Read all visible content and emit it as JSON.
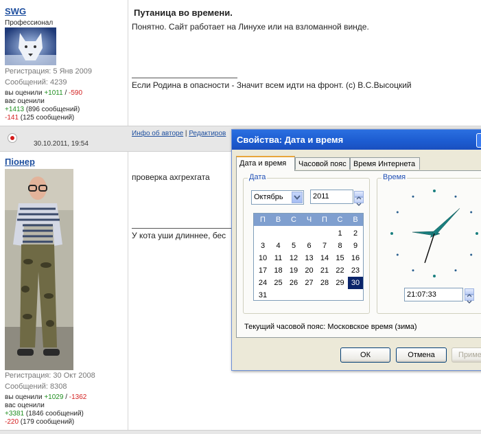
{
  "posts": [
    {
      "username": "SWG",
      "rank": "Профессионал",
      "registration": "Регистрация: 5 Янв 2009",
      "messages": "Сообщений: 4239",
      "rated_label": "вы оценили",
      "rated_pos": "+1011",
      "rated_sep": " / ",
      "rated_neg": "-590",
      "rated_you_label": "вас оценили",
      "rep_pos": "+1413",
      "rep_pos_count": " (896 сообщений)",
      "rep_neg": "-141",
      "rep_neg_count": " (125 сообщений)",
      "title": "Путаница во времени.",
      "text": "Понятно. Сайт работает на Линухе или на взломанной винде.",
      "signature": "Если Родина в опасности - Значит всем идти на фронт. (с) В.С.Высоцкий"
    },
    {
      "username": "Пiонер",
      "registration": "Регистрация: 30 Окт 2008",
      "messages": "Сообщений: 8308",
      "rated_label": "вы оценили",
      "rated_pos": "+1029",
      "rated_sep": " / ",
      "rated_neg": "-1362",
      "rated_you_label": "вас оценили",
      "rep_pos": "+3381",
      "rep_pos_count": " (1846 сообщений)",
      "rep_neg": "-220",
      "rep_neg_count": " (179 сообщений)",
      "text": "проверка ахгрехгата",
      "signature": "У кота уши длиннее, бес"
    }
  ],
  "bar": {
    "datetime": "30.10.2011, 19:54",
    "about_link": "Инфо об авторе",
    "separator": " | ",
    "edit_link": "Редактиров"
  },
  "dialog": {
    "title": "Свойства: Дата и время",
    "tabs": [
      "Дата и время",
      "Часовой пояс",
      "Время Интернета"
    ],
    "date_group": "Дата",
    "time_group": "Время",
    "month": "Октябрь",
    "year": "2011",
    "weekdays": [
      "П",
      "В",
      "С",
      "Ч",
      "П",
      "С",
      "В"
    ],
    "days": [
      [
        "",
        "",
        "",
        "",
        "",
        "1",
        "2"
      ],
      [
        "3",
        "4",
        "5",
        "6",
        "7",
        "8",
        "9"
      ],
      [
        "10",
        "11",
        "12",
        "13",
        "14",
        "15",
        "16"
      ],
      [
        "17",
        "18",
        "19",
        "20",
        "21",
        "22",
        "23"
      ],
      [
        "24",
        "25",
        "26",
        "27",
        "28",
        "29",
        "30"
      ],
      [
        "31",
        "",
        "",
        "",
        "",
        "",
        ""
      ]
    ],
    "selected_day": "30",
    "time": "21:07:33",
    "timezone": "Текущий часовой пояс: Московское время (зима)",
    "ok": "ОК",
    "cancel": "Отмена",
    "apply": "Примен"
  },
  "colors": {
    "accent": "#1d4e9e",
    "positive": "#1e8e1e",
    "negative": "#d32020",
    "titlebar": "#1c5bd0",
    "clock_hands": "#1a7f7f"
  }
}
